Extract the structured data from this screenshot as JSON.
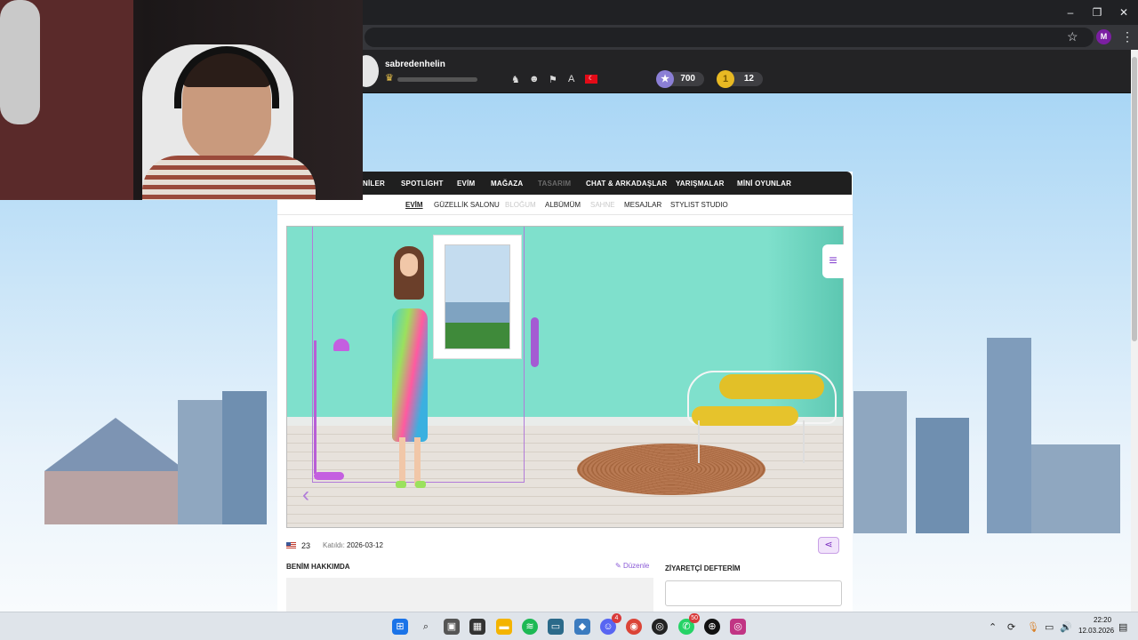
{
  "browser": {
    "minimize": "–",
    "maximize": "❐",
    "close": "✕",
    "star_icon": "☆",
    "profile_initial": "M",
    "menu_icon": "⋮"
  },
  "header": {
    "username": "sabredenhelin",
    "xp_progress": 0,
    "stars": "700",
    "coins": "12",
    "icons": [
      "bell-icon",
      "friends-icon",
      "bookmark-icon",
      "font-icon",
      "turkey-flag-icon"
    ]
  },
  "main_nav": [
    "YENİLİKLER",
    "SPOTLİGHT",
    "EVİM",
    "MAĞAZA",
    "TASARIM",
    "CHAT & ARKADAŞLAR",
    "YARIŞMALAR",
    "MİNİ OYUNLAR"
  ],
  "main_nav_visible": [
    "NİLER",
    "SPOTLİGHT",
    "EVİM",
    "MAĞAZA",
    "TASARIM",
    "CHAT & ARKADAŞLAR",
    "YARIŞMALAR",
    "MİNİ OYUNLAR"
  ],
  "sub_nav": [
    "EVİM",
    "GÜZELLİK SALONU",
    "BLOĞUM",
    "ALBÜMÜM",
    "SAHNE",
    "MESAJLAR",
    "STYLIST STUDIO"
  ],
  "profile": {
    "age": "23",
    "joined_label": "Katıldı:",
    "joined_value": "2026-03-12",
    "about_title": "BENİM HAKKIMDA",
    "edit_label": "Düzenle",
    "guestbook_title": "ZİYARETÇİ DEFTERİM"
  },
  "taskbar": {
    "time": "22:20",
    "date": "12.03.2026",
    "badges": {
      "discord": "4",
      "whatsapp": "50"
    },
    "apps": [
      "windows-start",
      "search",
      "task-view",
      "store",
      "file-explorer",
      "spotify",
      "app",
      "app",
      "discord",
      "chrome",
      "app",
      "whatsapp",
      "app",
      "instagram"
    ]
  },
  "colors": {
    "accent": "#8a4ad1",
    "nav_bg": "#1f1f1f",
    "room_wall": "#7fe0cc"
  }
}
